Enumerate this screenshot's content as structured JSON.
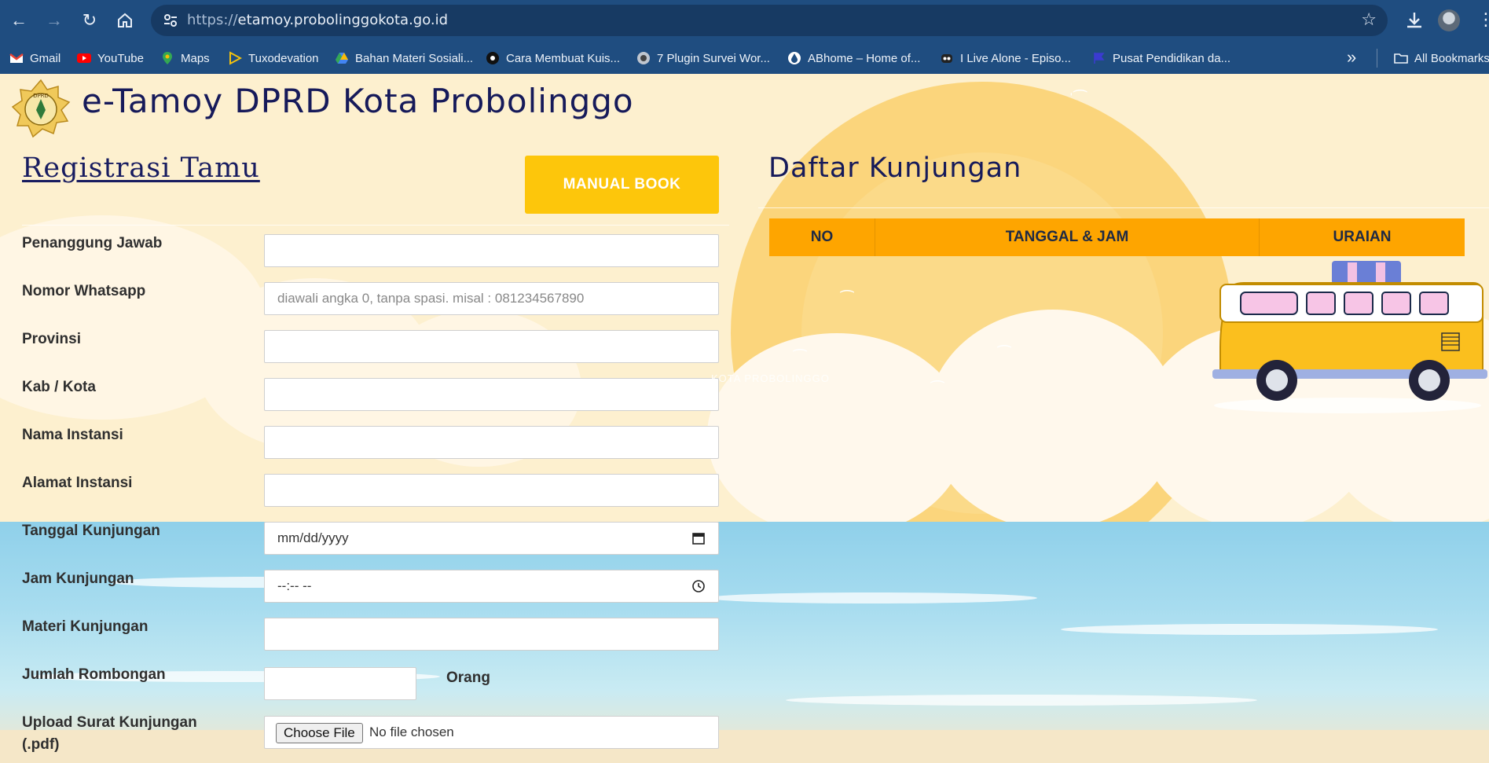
{
  "browser": {
    "url_protocol": "https://",
    "url_host": "etamoy.probolinggokota.go.id",
    "bookmarks": [
      {
        "label": "Gmail",
        "icon": "gmail-icon",
        "color": "#ea4335"
      },
      {
        "label": "YouTube",
        "icon": "youtube-icon",
        "color": "#ff0000"
      },
      {
        "label": "Maps",
        "icon": "maps-icon",
        "color": "#34a853"
      },
      {
        "label": "Tuxodevation",
        "icon": "play-outline-icon",
        "color": "#f4c20d"
      },
      {
        "label": "Bahan Materi Sosiali...",
        "icon": "drive-icon",
        "color": "#4285f4"
      },
      {
        "label": "Cara Membuat Kuis...",
        "icon": "circle-logo-icon",
        "color": "#111111"
      },
      {
        "label": "7 Plugin Survei Wor...",
        "icon": "gear-logo-icon",
        "color": "#cccccc"
      },
      {
        "label": "ABhome – Home of...",
        "icon": "drop-icon",
        "color": "#ffffff"
      },
      {
        "label": "I Live Alone - Episo...",
        "icon": "robot-icon",
        "color": "#222222"
      },
      {
        "label": "Pusat Pendidikan da...",
        "icon": "flag-icon",
        "color": "#3b3bd1"
      }
    ],
    "all_bookmarks_label": "All Bookmarks"
  },
  "site": {
    "title": "e-Tamoy DPRD Kota Probolinggo"
  },
  "registration": {
    "title": "Registrasi Tamu",
    "manual_button": "MANUAL BOOK",
    "fields": [
      {
        "label": "Penanggung Jawab",
        "placeholder": ""
      },
      {
        "label": "Nomor Whatsapp",
        "placeholder": "diawali angka 0, tanpa spasi. misal : 081234567890"
      },
      {
        "label": "Provinsi",
        "placeholder": ""
      },
      {
        "label": "Kab / Kota",
        "placeholder": ""
      },
      {
        "label": "Nama Instansi",
        "placeholder": ""
      },
      {
        "label": "Alamat Instansi",
        "placeholder": ""
      },
      {
        "label": "Tanggal Kunjungan",
        "placeholder": "mm/dd/yyyy"
      },
      {
        "label": "Jam Kunjungan",
        "placeholder": "--:-- --"
      },
      {
        "label": "Materi Kunjungan",
        "placeholder": ""
      }
    ],
    "jumlah_label": "Jumlah Rombongan",
    "orang_label": "Orang",
    "upload_label_line1": "Upload Surat Kunjungan",
    "upload_label_line2": "(.pdf)",
    "choose_file": "Choose File",
    "no_file": "No file chosen"
  },
  "daftar": {
    "title": "Daftar Kunjungan",
    "columns": [
      "NO",
      "TANGGAL & JAM",
      "URAIAN"
    ]
  },
  "watermark": "KOTA PROBOLINGGO",
  "colors": {
    "chrome_bg": "#1f4d80",
    "accent_yellow": "#fdc60b",
    "table_orange": "#fea500",
    "title_navy": "#161a5a"
  }
}
